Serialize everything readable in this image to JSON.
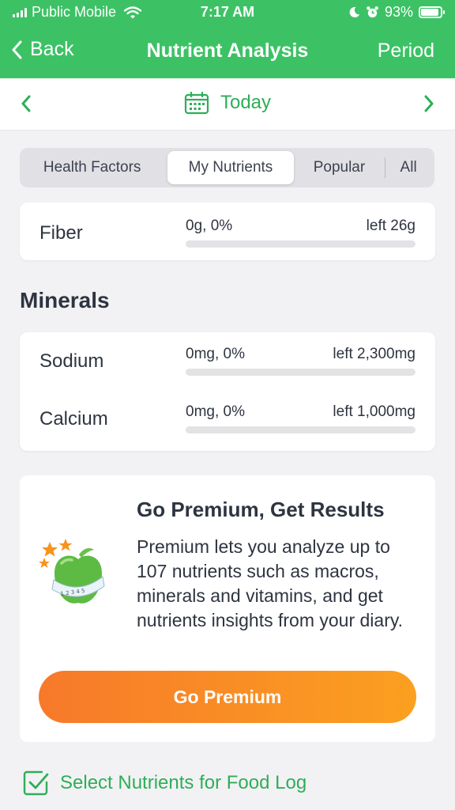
{
  "status": {
    "carrier": "Public Mobile",
    "time": "7:17 AM",
    "battery": "93%",
    "battery_level": 0.93
  },
  "nav": {
    "back_label": "Back",
    "title": "Nutrient Analysis",
    "period_label": "Period"
  },
  "date": {
    "label": "Today"
  },
  "tabs": [
    {
      "label": "Health Factors",
      "active": false
    },
    {
      "label": "My Nutrients",
      "active": true
    },
    {
      "label": "Popular",
      "active": false
    },
    {
      "label": "All",
      "active": false
    }
  ],
  "fiber": {
    "name": "Fiber",
    "amount": "0g, 0%",
    "left": "left 26g",
    "progress": 0
  },
  "minerals": {
    "title": "Minerals",
    "items": [
      {
        "name": "Sodium",
        "amount": "0mg, 0%",
        "left": "left 2,300mg",
        "progress": 0
      },
      {
        "name": "Calcium",
        "amount": "0mg, 0%",
        "left": "left 1,000mg",
        "progress": 0
      }
    ]
  },
  "promo": {
    "title": "Go Premium, Get Results",
    "body": "Premium lets you analyze up to 107 nutrients such as macros, minerals and vitamins, and get nutrients insights from your diary.",
    "button_label": "Go Premium",
    "icon": "apple-with-tape-measure-icon",
    "tape_numbers": "1 2 3 4 5"
  },
  "footer": {
    "select_label": "Select Nutrients for Food Log"
  },
  "colors": {
    "brand_green": "#3cc265",
    "link_green": "#2eae58",
    "premium_orange": "#f7792a",
    "premium_orange_end": "#fba020"
  }
}
